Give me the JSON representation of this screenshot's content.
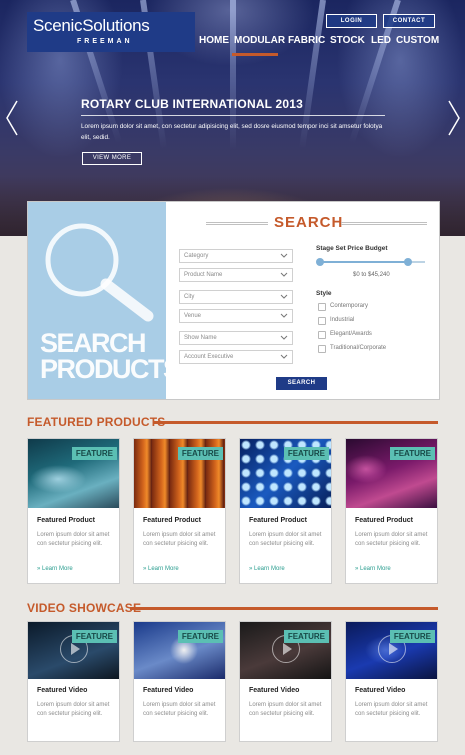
{
  "brand": {
    "name": "ScenicSolutions",
    "sub": "FREEMAN"
  },
  "top_buttons": {
    "login": "LOGIN",
    "contact": "CONTACT"
  },
  "nav": {
    "items": [
      "HOME",
      "MODULAR",
      "FABRIC",
      "STOCK",
      "LED",
      "CUSTOM"
    ],
    "active": "MODULAR"
  },
  "hero": {
    "title": "ROTARY CLUB INTERNATIONAL 2013",
    "text": "Lorem ipsum dolor sit amet, con sectetur adipisicing elit, sed dosre eiusmod tempor inci sit amsetur folotya elit, sedid.",
    "cta": "VIEW MORE"
  },
  "search": {
    "title": "SEARCH",
    "side_label_line1": "SEARCH",
    "side_label_line2": "PRODUCTS",
    "fields": [
      "Category",
      "Product Name",
      "City",
      "Venue",
      "Show Name",
      "Account Executive"
    ],
    "budget_label": "Stage Set Price Budget",
    "price_range": "$0 to $45,240",
    "style_label": "Style",
    "styles": [
      "Contemporary",
      "Industrial",
      "Elegant/Awards",
      "Traditional/Corporate"
    ],
    "button": "SEARCH"
  },
  "featured": {
    "title": "FEATURED PRODUCTS",
    "badge": "FEATURE",
    "cards": [
      {
        "title": "Featured Product",
        "text": "Lorem ipsum dolor sit amet con sectetur pisicing elit.",
        "link": "» Learn More"
      },
      {
        "title": "Featured Product",
        "text": "Lorem ipsum dolor sit amet con sectetur pisicing elit.",
        "link": "» Learn More"
      },
      {
        "title": "Featured Product",
        "text": "Lorem ipsum dolor sit amet con sectetur pisicing elit.",
        "link": "» Learn More"
      },
      {
        "title": "Featured Product",
        "text": "Lorem ipsum dolor sit amet con sectetur pisicing elit.",
        "link": "» Learn More"
      }
    ]
  },
  "videos": {
    "title": "VIDEO SHOWCASE",
    "badge": "FEATURE",
    "cards": [
      {
        "title": "Featured Video",
        "text": "Lorem ipsum dolor sit amet con sectetur pisicing elit."
      },
      {
        "title": "Featured Video",
        "text": "Lorem ipsum dolor sit amet con sectetur pisicing elit."
      },
      {
        "title": "Featured Video",
        "text": "Lorem ipsum dolor sit amet con sectetur pisicing elit."
      },
      {
        "title": "Featured Video",
        "text": "Lorem ipsum dolor sit amet con sectetur pisicing elit."
      }
    ]
  },
  "colors": {
    "brand_blue": "#1f3b87",
    "accent_orange": "#c55a2b",
    "feature_teal": "#5bbfb3",
    "search_panel_blue": "#a9cde6"
  }
}
